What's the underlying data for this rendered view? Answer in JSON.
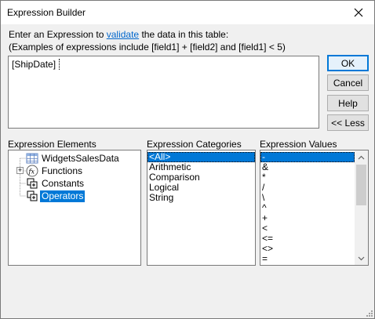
{
  "window": {
    "title": "Expression Builder",
    "close_label": "✕"
  },
  "intro": {
    "line1_prefix": "Enter an Expression to ",
    "line1_link": "validate",
    "line1_suffix": " the data in this table:",
    "line2": "(Examples of expressions include [field1] + [field2] and [field1] < 5)"
  },
  "expression": {
    "value": "[ShipDate]"
  },
  "buttons": {
    "ok": "OK",
    "cancel": "Cancel",
    "help": "Help",
    "less": "<< Less"
  },
  "elements": {
    "label": "Expression Elements",
    "items": [
      "WidgetsSalesData",
      "Functions",
      "Constants",
      "Operators"
    ],
    "selected": "Operators"
  },
  "categories": {
    "label": "Expression Categories",
    "items": [
      "<All>",
      "Arithmetic",
      "Comparison",
      "Logical",
      "String"
    ],
    "selected": "<All>"
  },
  "values": {
    "label": "Expression Values",
    "items": [
      "-",
      "&",
      "*",
      "/",
      "\\",
      "^",
      "+",
      "<",
      "<=",
      "<>",
      "="
    ],
    "selected": "-"
  },
  "colors": {
    "selection": "#0078d7",
    "link": "#0066cc",
    "default_button_border": "#0078d7"
  },
  "icons": {
    "table": "table-icon",
    "functions": "fx-icon",
    "constants": "constants-icon",
    "operators": "operators-icon"
  }
}
